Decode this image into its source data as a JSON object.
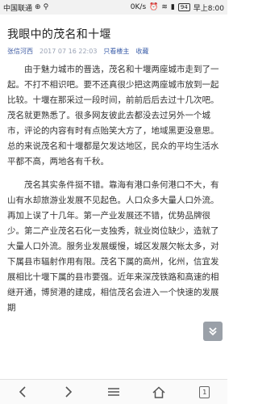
{
  "status_bar": {
    "carrier": "中国联通",
    "speed": "0K/s",
    "battery": "94",
    "time": "早上8:00"
  },
  "article": {
    "title": "我眼中的茂名和十堰",
    "author": "张信河西",
    "date": "2017 07 16 22:03",
    "author_only": "只看楼主",
    "favorite": "收藏",
    "paragraphs": [
      "由于魅力城市的晋选，茂名和十堰两座城市走到了一起。不打不相识吧。要不还真很少把这两座城市放到一起比较。十堰在那采过一段时间，前前后后去过十几次吧。茂名就更熟悉了。很多网友彼此去都没去过另外一个城市，评论的内容有时有点贻笑大方了，地域黑更没意思。总的来说茂名和十堰都是欠发达地区，民众的平均生活水平都不高，两地各有千秋。",
      "茂名其实条件挺不错。靠海有港口条何港口不大，有山有水却旅游业发展不见起色。人口众多大量人口外流。再加上误了十几年。第一产业发展还不错，优势品牌很少。第二产业茂名石化一支独秀，就业岗位缺少，造就了大量人口外流。服务业发展缓慢，城区发展欠帐太多，对下属县市辐射作用有限。茂名下属的高州，化州，信宜发展相比十堰下属的县市要强。近年来深茂铁路和高速的相继开通，博贸港的建成，相信茂名会进入一个快速的发展期"
    ]
  },
  "nav": {
    "tab_count": "1"
  }
}
